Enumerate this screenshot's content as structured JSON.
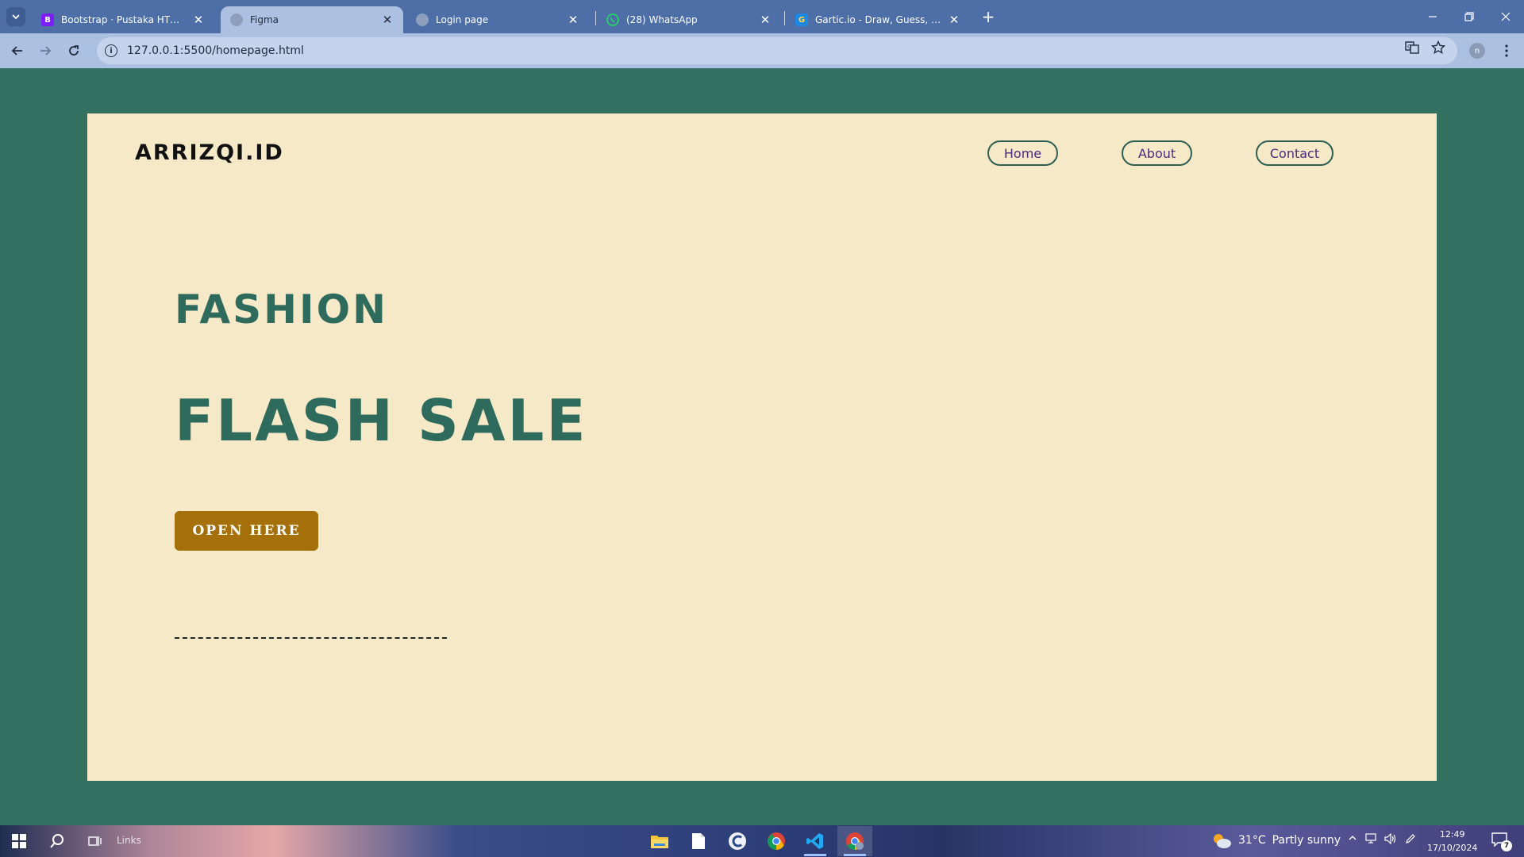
{
  "browser": {
    "tabs": [
      {
        "title": "Bootstrap · Pustaka HTML, CSS, dan JS paling populer di dunia.",
        "favicon": "B",
        "favicon_color": "#7b1dfc",
        "active": false
      },
      {
        "title": "Figma",
        "favicon": "",
        "favicon_color": "#8d9fbd",
        "active": true
      },
      {
        "title": "Login page",
        "favicon": "",
        "favicon_color": "#8d9fbd",
        "active": false
      },
      {
        "title": "(28) WhatsApp",
        "favicon": "whatsapp-icon",
        "favicon_color": "#25d366",
        "active": false
      },
      {
        "title": "Gartic.io - Draw, Guess, WIN",
        "favicon": "G",
        "favicon_color": "#1e88e5",
        "active": false
      }
    ],
    "url": "127.0.0.1:5500/homepage.html",
    "profile_initial": "n"
  },
  "site": {
    "logo": "ARRIZQI.ID",
    "nav": [
      {
        "label": "Home"
      },
      {
        "label": "About"
      },
      {
        "label": "Contact"
      }
    ],
    "hero_small": "FASHION",
    "hero_big": "FLASH SALE",
    "cta_label": "OPEN HERE"
  },
  "taskbar": {
    "search_text": "Links",
    "weather_temp": "31°C",
    "weather_desc": "Partly sunny",
    "time": "12:49",
    "date": "17/10/2024",
    "notification_count": "7"
  },
  "colors": {
    "page_background": "#347061",
    "card_background": "#f6e9c8",
    "hero_text": "#2e6b5c",
    "cta_background": "#a5700a"
  }
}
